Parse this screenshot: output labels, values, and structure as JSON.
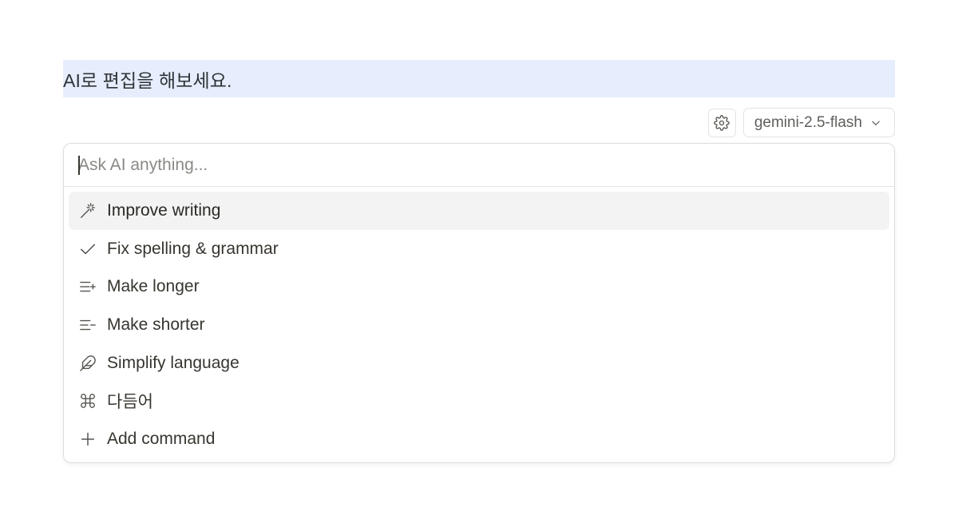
{
  "editor": {
    "selected_text": "AI로 편집을 해보세요."
  },
  "toolbar": {
    "settings_icon": "gear-icon",
    "model_label": "gemini-2.5-flash",
    "model_icon": "chevron-down-icon"
  },
  "ask": {
    "placeholder": "Ask AI anything...",
    "value": ""
  },
  "menu": {
    "items": [
      {
        "label": "Improve writing",
        "icon": "magic-wand-icon",
        "active": true
      },
      {
        "label": "Fix spelling & grammar",
        "icon": "check-icon",
        "active": false
      },
      {
        "label": "Make longer",
        "icon": "lines-plus-icon",
        "active": false
      },
      {
        "label": "Make shorter",
        "icon": "lines-minus-icon",
        "active": false
      },
      {
        "label": "Simplify language",
        "icon": "feather-icon",
        "active": false
      },
      {
        "label": "다듬어",
        "icon": "command-icon",
        "active": false
      },
      {
        "label": "Add command",
        "icon": "plus-icon",
        "active": false
      }
    ]
  },
  "colors": {
    "selection_highlight": "#e6edfd",
    "active_item_bg": "#f3f3f3"
  }
}
